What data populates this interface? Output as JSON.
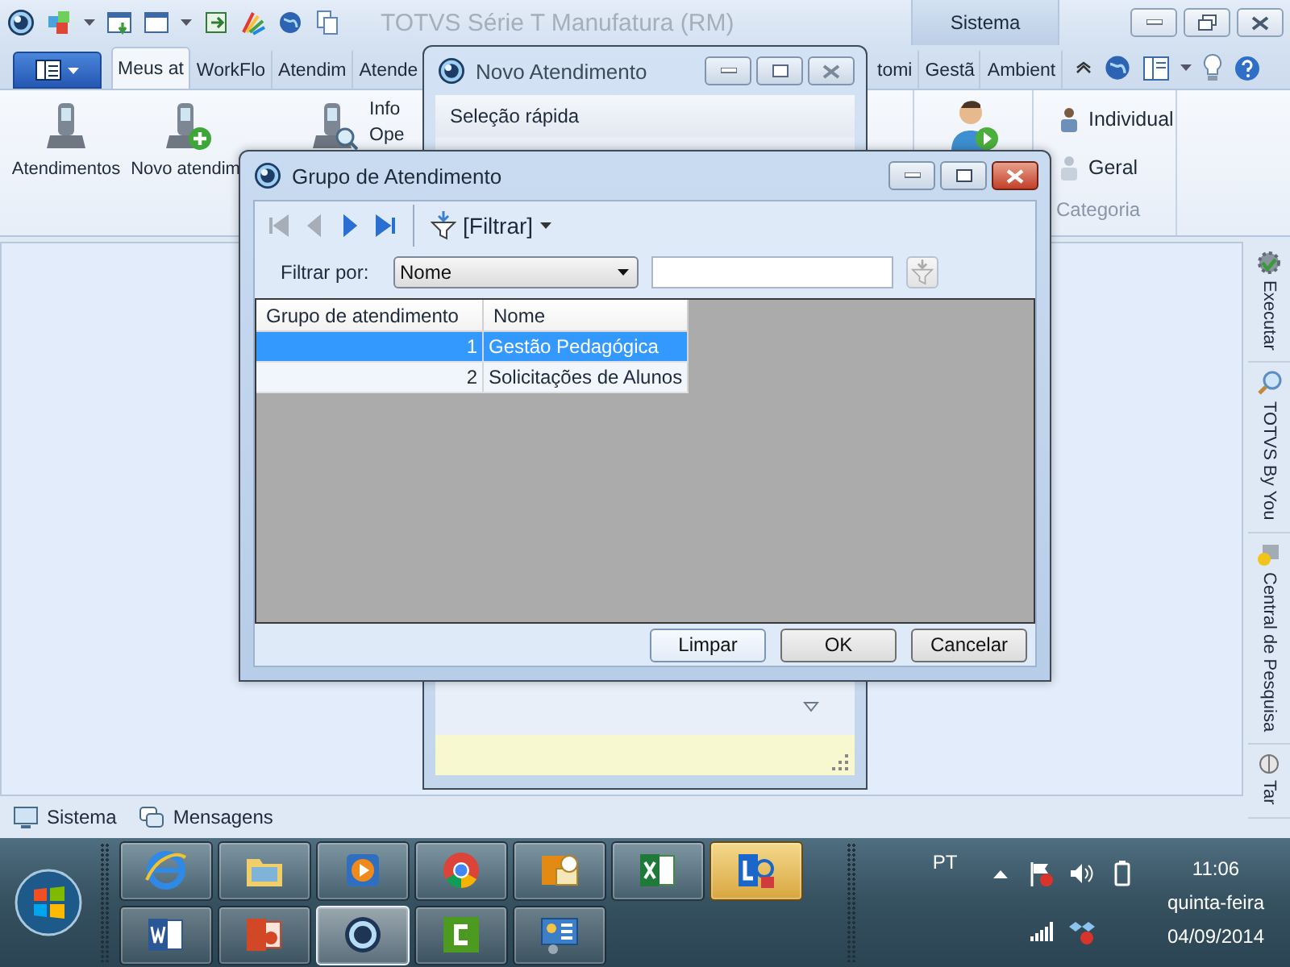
{
  "main_window": {
    "title": "TOTVS Série T Manufatura (RM)",
    "context_tab": "Sistema"
  },
  "ribbon_tabs": [
    {
      "label": "Meus at",
      "selected": true
    },
    {
      "label": "WorkFlo",
      "selected": false
    },
    {
      "label": "Atendim",
      "selected": false
    },
    {
      "label": "Atende",
      "selected": false
    },
    {
      "label": "tomi",
      "selected": false
    },
    {
      "label": "Gestã",
      "selected": false
    },
    {
      "label": "Ambient",
      "selected": false
    }
  ],
  "ribbon_left": [
    {
      "kind": "phone",
      "label": "Atendimentos"
    },
    {
      "kind": "phone-add",
      "label": "Novo atendim"
    },
    {
      "kind": "phone-search"
    }
  ],
  "ribbon_links": [
    "Info",
    "Ope"
  ],
  "ribbon_category": {
    "items": [
      "Individual",
      "Geral"
    ],
    "label": "Categoria"
  },
  "side_tabs": [
    "Executar",
    "TOTVS By You",
    "Central de Pesquisa",
    "Tar"
  ],
  "status_tabs": [
    "Sistema",
    "Mensagens"
  ],
  "novo_dialog": {
    "title": "Novo Atendimento",
    "quick_select": "Seleção rápida"
  },
  "grupo_dialog": {
    "title": "Grupo de Atendimento",
    "nav": [
      {
        "kind": "first",
        "disabled": true
      },
      {
        "kind": "prev",
        "disabled": true
      },
      {
        "kind": "next",
        "disabled": false
      },
      {
        "kind": "last",
        "disabled": false
      }
    ],
    "filter_button": "[Filtrar]",
    "filter_label": "Filtrar por:",
    "filter_field": "Nome",
    "columns": [
      "Grupo de atendimento",
      "Nome"
    ],
    "rows": [
      {
        "id": "1",
        "name": "Gestão Pedagógica",
        "selected": true
      },
      {
        "id": "2",
        "name": "Solicitações de Alunos",
        "selected": false
      }
    ],
    "buttons": [
      "Limpar",
      "OK",
      "Cancelar"
    ]
  },
  "taskbar": {
    "apps": [
      {
        "kind": "ie",
        "active": false,
        "flashing": false
      },
      {
        "kind": "explorer",
        "active": false,
        "flashing": false
      },
      {
        "kind": "media",
        "active": false,
        "flashing": false
      },
      {
        "kind": "chrome",
        "active": false,
        "flashing": false
      },
      {
        "kind": "outlook",
        "active": false,
        "flashing": false
      },
      {
        "kind": "excel",
        "active": false,
        "flashing": false
      },
      {
        "kind": "lync",
        "active": false,
        "flashing": true
      },
      {
        "kind": "word",
        "active": false,
        "flashing": false
      },
      {
        "kind": "powerpoint",
        "active": false,
        "flashing": false
      },
      {
        "kind": "totvs",
        "active": true,
        "flashing": false
      },
      {
        "kind": "camtasia",
        "active": false,
        "flashing": false
      },
      {
        "kind": "control",
        "active": false,
        "flashing": false
      }
    ],
    "language": "PT",
    "time": "11:06",
    "day": "quinta-feira",
    "date": "04/09/2014"
  }
}
